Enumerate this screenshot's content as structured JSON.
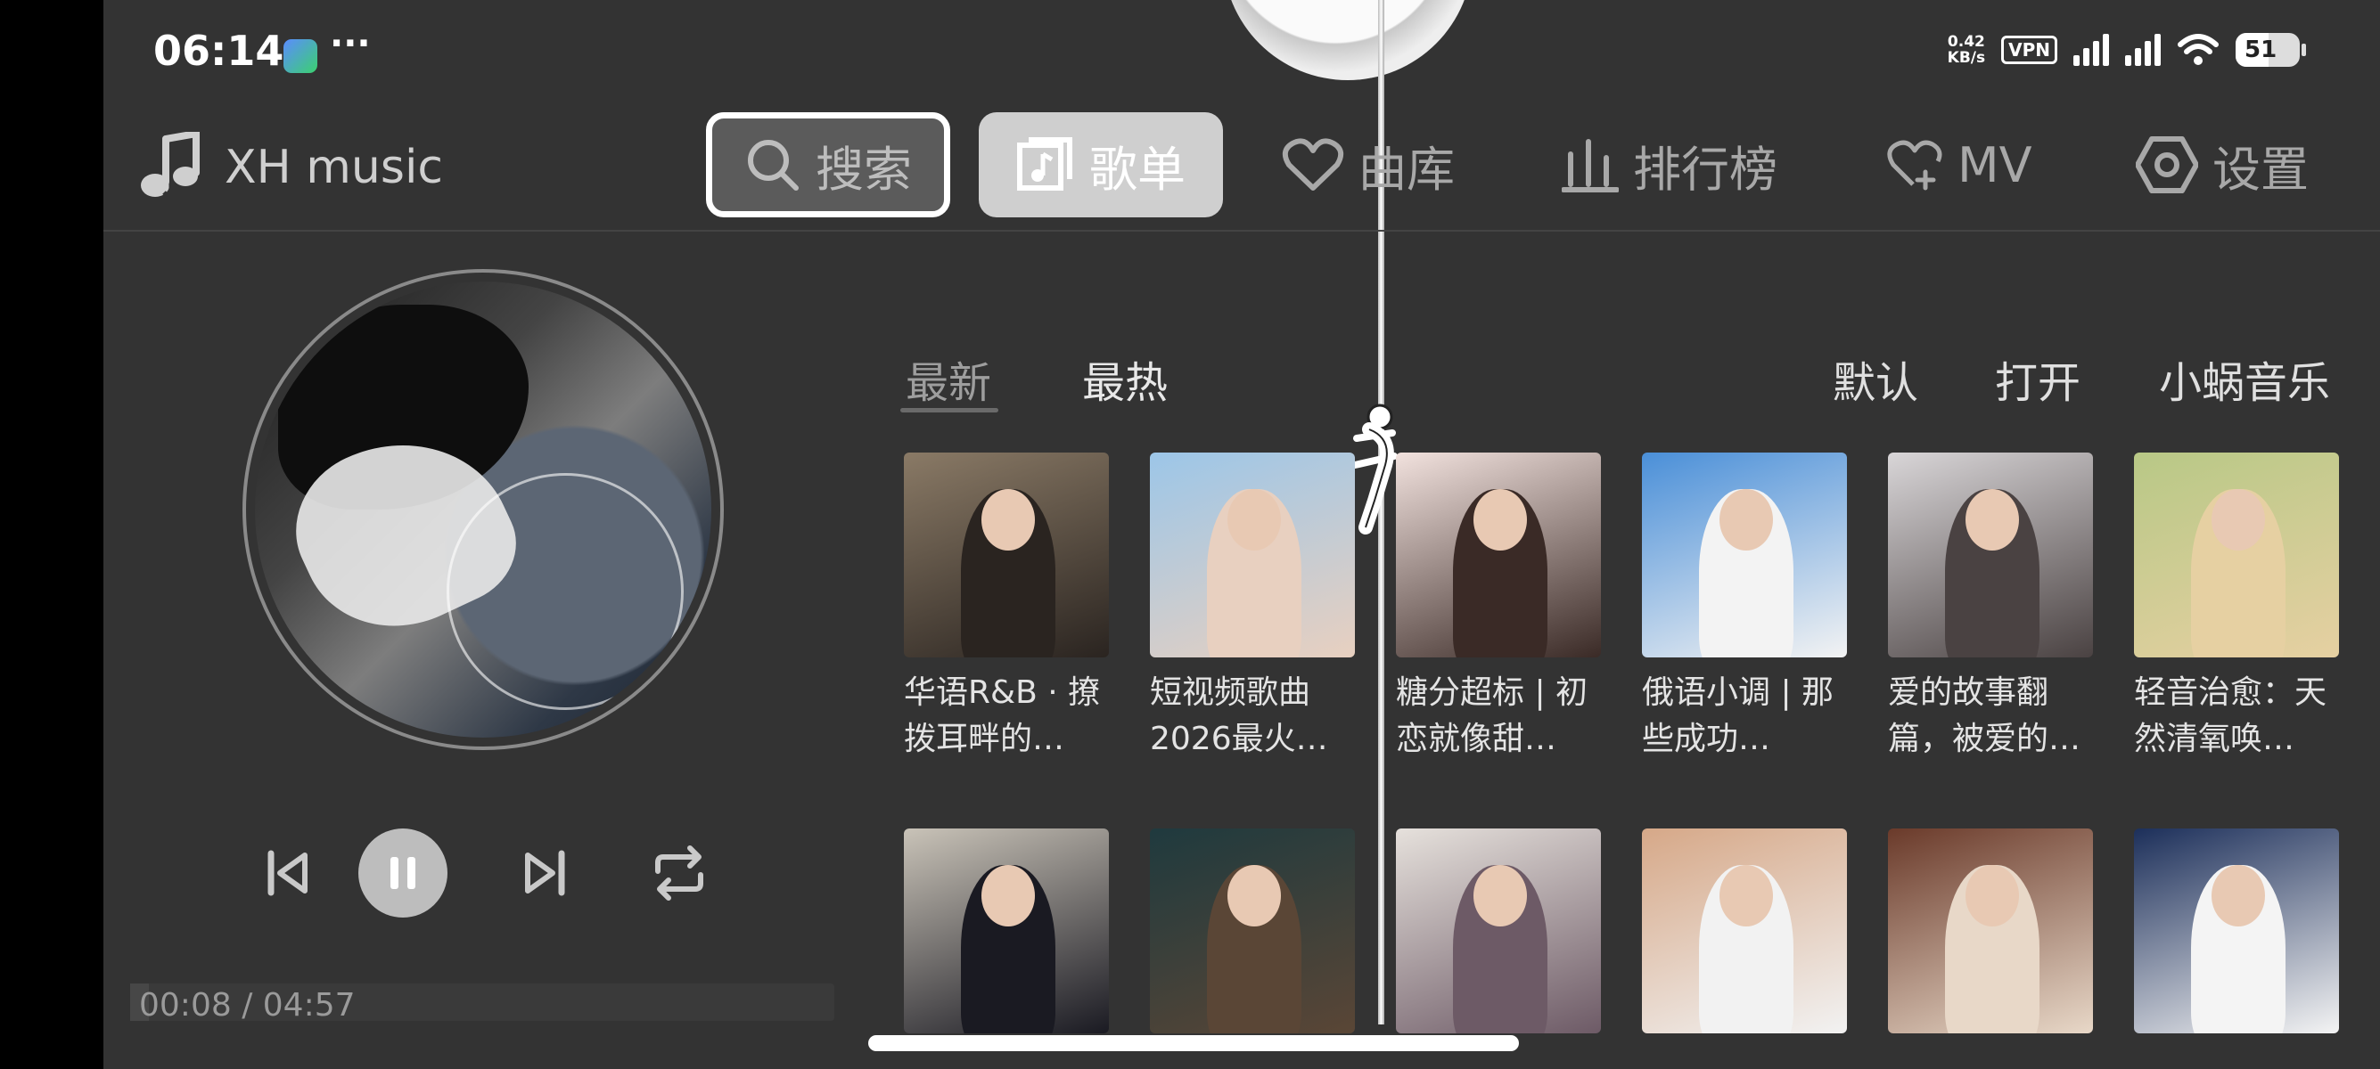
{
  "status": {
    "time": "06:14",
    "dots": "···",
    "net_speed_value": "0.42",
    "net_speed_unit": "KB/s",
    "vpn": "VPN",
    "battery": "51",
    "battery_level": 0.51
  },
  "brand": {
    "name": "XH music"
  },
  "nav": [
    {
      "label": "搜索",
      "icon": "search-icon"
    },
    {
      "label": "歌单",
      "icon": "playlist-icon"
    },
    {
      "label": "曲库",
      "icon": "heart-icon"
    },
    {
      "label": "排行榜",
      "icon": "bar-chart-icon"
    },
    {
      "label": "MV",
      "icon": "mv-heart-icon"
    },
    {
      "label": "设置",
      "icon": "gear-icon"
    }
  ],
  "player": {
    "current_time": "00:08",
    "separator": " / ",
    "duration": "04:57",
    "progress": 0.027
  },
  "tabs": {
    "latest": "最新",
    "hot": "最热"
  },
  "sources": {
    "default": "默认",
    "open": "打开",
    "xiaowo": "小蜗音乐"
  },
  "playlists": [
    {
      "title": "华语R&B · 撩拨耳畔的…",
      "colors": [
        "#8a7a66",
        "#2a2420"
      ]
    },
    {
      "title": "短视频歌曲2026最火…",
      "colors": [
        "#9cc6e8",
        "#e8d0c0"
      ]
    },
    {
      "title": "糖分超标 | 初恋就像甜…",
      "colors": [
        "#f2e2de",
        "#3a2a26"
      ]
    },
    {
      "title": "俄语小调 | 那些成功…",
      "colors": [
        "#4a8fd8",
        "#f3f3f3"
      ]
    },
    {
      "title": "爱的故事翻篇，被爱的…",
      "colors": [
        "#d9d6d8",
        "#4a4242"
      ]
    },
    {
      "title": "轻音治愈：天然清氧唤…",
      "colors": [
        "#b8c886",
        "#e6d0a2"
      ]
    },
    {
      "title": "",
      "colors": [
        "#c9c3b8",
        "#1a1a22"
      ]
    },
    {
      "title": "",
      "colors": [
        "#1f3a3e",
        "#5a4636"
      ]
    },
    {
      "title": "",
      "colors": [
        "#e6e1dc",
        "#6d5a66"
      ]
    },
    {
      "title": "",
      "colors": [
        "#d6a888",
        "#f2f2f2"
      ]
    },
    {
      "title": "",
      "colors": [
        "#6a3a2a",
        "#e8d8c8"
      ]
    },
    {
      "title": "",
      "colors": [
        "#1c2f5a",
        "#f4f4f4"
      ]
    }
  ]
}
